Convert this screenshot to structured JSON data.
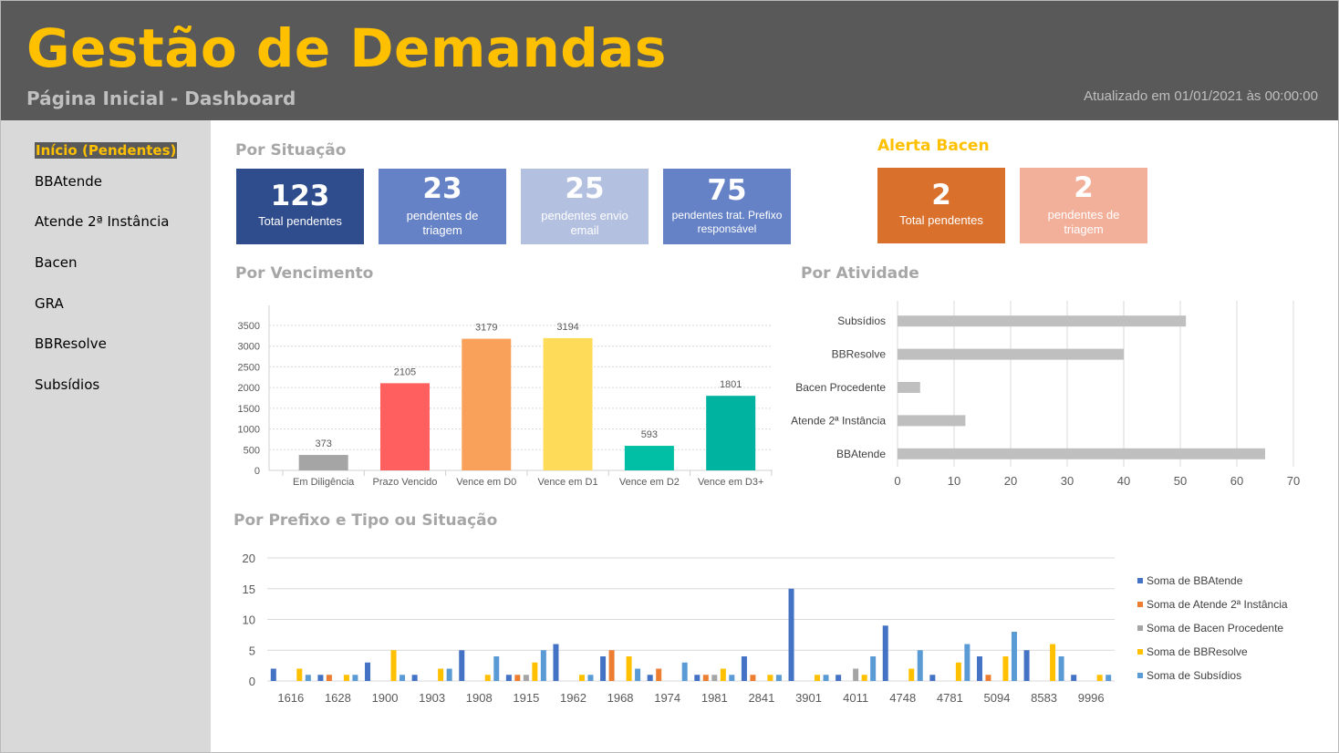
{
  "header": {
    "title": "Gestão de Demandas",
    "subtitle": "Página Inicial - Dashboard",
    "updated": "Atualizado em 01/01/2021 às 00:00:00"
  },
  "sidebar": {
    "items": [
      {
        "label": "Início (Pendentes)",
        "active": true
      },
      {
        "label": "BBAtende",
        "active": false
      },
      {
        "label": "Atende 2ª Instância",
        "active": false
      },
      {
        "label": "Bacen",
        "active": false
      },
      {
        "label": "GRA",
        "active": false
      },
      {
        "label": "BBResolve",
        "active": false
      },
      {
        "label": "Subsídios",
        "active": false
      }
    ]
  },
  "situacao": {
    "title": "Por Situação",
    "cards": [
      {
        "value": "123",
        "label": "Total pendentes",
        "color": "#2f4d8c"
      },
      {
        "value": "23",
        "label": "pendentes de triagem",
        "color": "#6682c6"
      },
      {
        "value": "25",
        "label": "pendentes envio email",
        "color": "#b4c0e0"
      },
      {
        "value": "75",
        "label": "pendentes trat. Prefixo responsável",
        "color": "#6682c6"
      }
    ]
  },
  "alerta": {
    "title": "Alerta Bacen",
    "cards": [
      {
        "value": "2",
        "label": "Total pendentes",
        "color": "#d9712d"
      },
      {
        "value": "2",
        "label": "pendentes de triagem",
        "color": "#f2b09b"
      }
    ]
  },
  "sections": {
    "vencimento": "Por Vencimento",
    "atividade": "Por Atividade",
    "prefixo": "Por Prefixo e Tipo ou Situação"
  },
  "chart_data": [
    {
      "id": "vencimento",
      "type": "bar",
      "categories": [
        "Em Diligência",
        "Prazo Vencido",
        "Vence em D0",
        "Vence em D1",
        "Vence em D2",
        "Vence em D3+"
      ],
      "values": [
        373,
        2105,
        3179,
        3194,
        593,
        1801
      ],
      "colors": [
        "#a5a5a5",
        "#ff5f5f",
        "#f9a15a",
        "#ffdb5a",
        "#00bfa5",
        "#00b3a0"
      ],
      "yticks": [
        0,
        500,
        1000,
        1500,
        2000,
        2500,
        3000,
        3500
      ],
      "ylim": [
        0,
        3500
      ],
      "grid": true,
      "data_labels": true
    },
    {
      "id": "atividade",
      "type": "bar",
      "orientation": "horizontal",
      "categories": [
        "Subsídios",
        "BBResolve",
        "Bacen Procedente",
        "Atende 2ª Instância",
        "BBAtende"
      ],
      "values": [
        51,
        40,
        4,
        12,
        65
      ],
      "color": "#bfbfbf",
      "xticks": [
        0,
        10,
        20,
        30,
        40,
        50,
        60,
        70
      ],
      "xlim": [
        0,
        70
      ],
      "grid": true
    },
    {
      "id": "prefixo",
      "type": "bar",
      "categories": [
        "1616",
        "1628",
        "1900",
        "1903",
        "1908",
        "1915",
        "1962",
        "1968",
        "1974",
        "1981",
        "2841",
        "3901",
        "4011",
        "4748",
        "4781",
        "5094",
        "8583",
        "9996"
      ],
      "yticks": [
        0,
        5,
        10,
        15,
        20
      ],
      "ylim": [
        0,
        20
      ],
      "grid": true,
      "legend_position": "right",
      "series": [
        {
          "name": "Soma de BBAtende",
          "color": "#4472c4",
          "values": [
            2,
            1,
            3,
            1,
            5,
            1,
            6,
            4,
            1,
            1,
            4,
            15,
            1,
            9,
            1,
            4,
            5,
            1
          ]
        },
        {
          "name": "Soma de Atende 2ª Instância",
          "color": "#ed7d31",
          "values": [
            0,
            1,
            0,
            0,
            0,
            1,
            0,
            5,
            2,
            1,
            1,
            0,
            0,
            0,
            0,
            1,
            0,
            0
          ]
        },
        {
          "name": "Soma de Bacen Procedente",
          "color": "#a5a5a5",
          "values": [
            0,
            0,
            0,
            0,
            0,
            1,
            0,
            0,
            0,
            1,
            0,
            0,
            2,
            0,
            0,
            0,
            0,
            0
          ]
        },
        {
          "name": "Soma de BBResolve",
          "color": "#ffc000",
          "values": [
            2,
            1,
            5,
            2,
            1,
            3,
            1,
            4,
            0,
            2,
            1,
            1,
            1,
            2,
            3,
            4,
            6,
            1
          ]
        },
        {
          "name": "Soma de Subsídios",
          "color": "#5b9bd5",
          "values": [
            1,
            1,
            1,
            2,
            4,
            5,
            1,
            2,
            3,
            1,
            1,
            1,
            4,
            5,
            6,
            8,
            4,
            1
          ]
        }
      ]
    }
  ]
}
